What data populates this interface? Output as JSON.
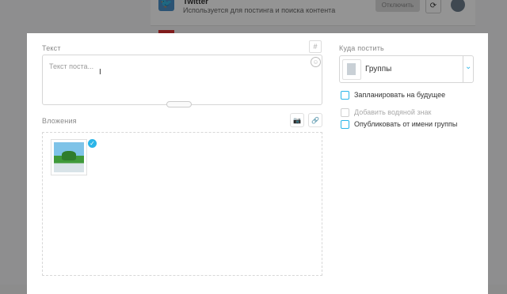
{
  "background": {
    "twitter_title": "Twitter",
    "twitter_desc": "Используется для постинга и поиска контента",
    "disconnect_label": "Отключить",
    "refresh_icon": "refresh-icon",
    "twitter_icon": "twitter-icon"
  },
  "modal": {
    "text_label": "Текст",
    "hashtag_symbol": "#",
    "text_placeholder": "Текст поста...",
    "cursor_glyph": "I",
    "emoji_glyph": "☺",
    "attachments_label": "Вложения",
    "camera_glyph": "📷",
    "link_glyph": "🔗",
    "where_label": "Куда постить",
    "target_value": "Группы",
    "chevron_glyph": "⌄",
    "check_glyph": "✓",
    "options": [
      {
        "label": "Запланировать на будущее",
        "enabled": true,
        "checked": false
      },
      {
        "label": "Добавить водяной знак",
        "enabled": false,
        "checked": false
      },
      {
        "label": "Опубликовать от имени группы",
        "enabled": true,
        "checked": false
      }
    ]
  },
  "colors": {
    "accent": "#2bb5e8",
    "twitter": "#4a90c9"
  }
}
